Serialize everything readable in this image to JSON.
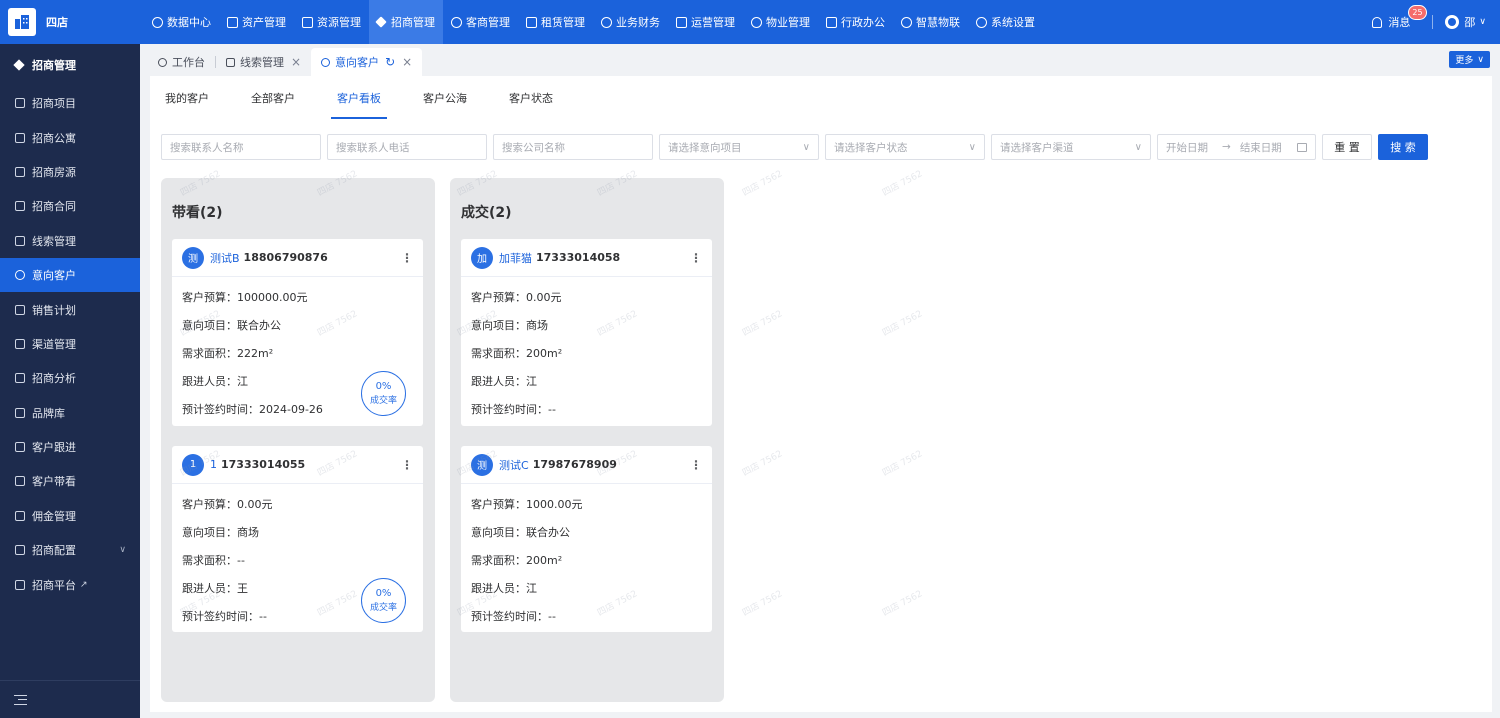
{
  "app": {
    "logo_text": "四店"
  },
  "topnav": [
    {
      "label": "数据中心",
      "icon": "dashboard-icon"
    },
    {
      "label": "资产管理",
      "icon": "cube-icon"
    },
    {
      "label": "资源管理",
      "icon": "building-icon"
    },
    {
      "label": "招商管理",
      "icon": "tag-icon",
      "active": true
    },
    {
      "label": "客商管理",
      "icon": "users-icon"
    },
    {
      "label": "租赁管理",
      "icon": "house-icon"
    },
    {
      "label": "业务财务",
      "icon": "coin-icon"
    },
    {
      "label": "运营管理",
      "icon": "grid-icon"
    },
    {
      "label": "物业管理",
      "icon": "home-icon"
    },
    {
      "label": "行政办公",
      "icon": "monitor-icon"
    },
    {
      "label": "智慧物联",
      "icon": "iot-icon"
    },
    {
      "label": "系统设置",
      "icon": "gear-icon"
    }
  ],
  "topright": {
    "messages_label": "消息",
    "messages_count": "25",
    "user_name": "邵"
  },
  "sidebar": {
    "header": "招商管理",
    "items": [
      {
        "label": "招商项目"
      },
      {
        "label": "招商公寓"
      },
      {
        "label": "招商房源"
      },
      {
        "label": "招商合同"
      },
      {
        "label": "线索管理"
      },
      {
        "label": "意向客户",
        "active": true
      },
      {
        "label": "销售计划"
      },
      {
        "label": "渠道管理"
      },
      {
        "label": "招商分析"
      },
      {
        "label": "品牌库"
      },
      {
        "label": "客户跟进"
      },
      {
        "label": "客户带看"
      },
      {
        "label": "佣金管理"
      },
      {
        "label": "招商配置",
        "expandable": true
      },
      {
        "label": "招商平台",
        "external": true
      }
    ]
  },
  "tabs": [
    {
      "label": "工作台"
    },
    {
      "label": "线索管理",
      "closable": true
    },
    {
      "label": "意向客户",
      "active": true,
      "closable": true
    }
  ],
  "more_label": "更多",
  "subtabs": [
    {
      "label": "我的客户"
    },
    {
      "label": "全部客户"
    },
    {
      "label": "客户看板",
      "active": true
    },
    {
      "label": "客户公海"
    },
    {
      "label": "客户状态"
    }
  ],
  "filters": {
    "contact_name_placeholder": "搜索联系人名称",
    "contact_phone_placeholder": "搜索联系人电话",
    "company_placeholder": "搜索公司名称",
    "project_placeholder": "请选择意向项目",
    "status_placeholder": "请选择客户状态",
    "channel_placeholder": "请选择客户渠道",
    "start_date_placeholder": "开始日期",
    "end_date_placeholder": "结束日期",
    "reset_label": "重 置",
    "search_label": "搜 索"
  },
  "watermark": "四店 7562",
  "columns": [
    {
      "title": "带看(2)",
      "cards": [
        {
          "avatar": "测",
          "name": "测试B",
          "phone": "18806790876",
          "budget": "客户预算：100000.00元",
          "project": "意向项目：联合办公",
          "area": "需求面积：222m²",
          "follower": "跟进人员：江",
          "sign_time": "预计签约时间：2024-09-26",
          "rate": "0%",
          "rate_label": "成交率"
        },
        {
          "avatar": "1",
          "name": "1",
          "phone": "17333014055",
          "budget": "客户预算：0.00元",
          "project": "意向项目：商场",
          "area": "需求面积：--",
          "follower": "跟进人员：王",
          "sign_time": "预计签约时间：--",
          "rate": "0%",
          "rate_label": "成交率"
        }
      ]
    },
    {
      "title": "成交(2)",
      "cards": [
        {
          "avatar": "加",
          "name": "加菲猫",
          "phone": "17333014058",
          "budget": "客户预算：0.00元",
          "project": "意向项目：商场",
          "area": "需求面积：200m²",
          "follower": "跟进人员：江",
          "sign_time": "预计签约时间：--"
        },
        {
          "avatar": "测",
          "name": "测试C",
          "phone": "17987678909",
          "budget": "客户预算：1000.00元",
          "project": "意向项目：联合办公",
          "area": "需求面积：200m²",
          "follower": "跟进人员：江",
          "sign_time": "预计签约时间：--"
        }
      ]
    }
  ]
}
